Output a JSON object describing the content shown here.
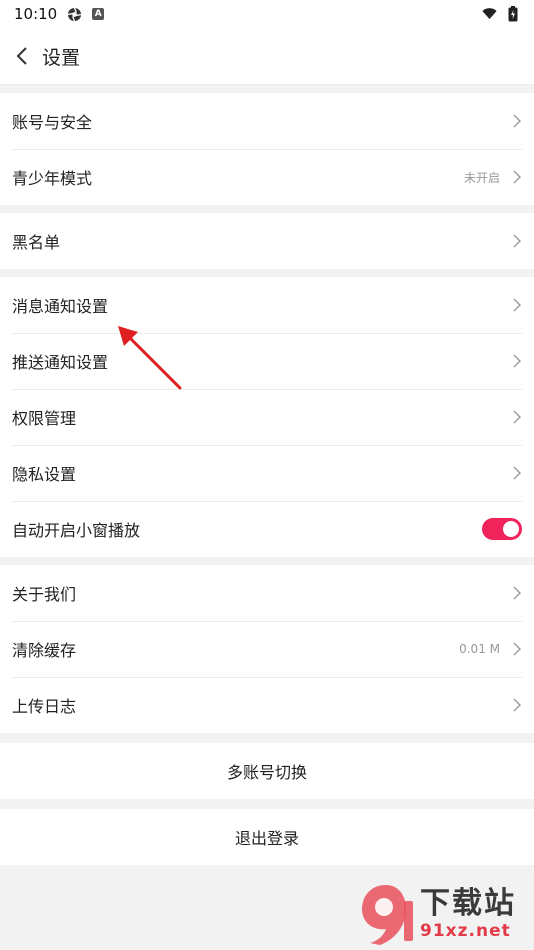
{
  "status_bar": {
    "time": "10:10"
  },
  "header": {
    "title": "设置"
  },
  "groups": [
    {
      "items": [
        {
          "label": "账号与安全",
          "value": ""
        },
        {
          "label": "青少年模式",
          "value": "未开启"
        }
      ]
    },
    {
      "items": [
        {
          "label": "黑名单",
          "value": ""
        }
      ]
    },
    {
      "items": [
        {
          "label": "消息通知设置",
          "value": ""
        },
        {
          "label": "推送通知设置",
          "value": ""
        },
        {
          "label": "权限管理",
          "value": ""
        },
        {
          "label": "隐私设置",
          "value": ""
        },
        {
          "label": "自动开启小窗播放",
          "value": "",
          "toggle_on": true
        }
      ]
    },
    {
      "items": [
        {
          "label": "关于我们",
          "value": ""
        },
        {
          "label": "清除缓存",
          "value": "0.01 M"
        },
        {
          "label": "上传日志",
          "value": ""
        }
      ]
    }
  ],
  "actions": {
    "switch_account": "多账号切换",
    "logout": "退出登录"
  },
  "colors": {
    "toggle_on": "#f0245a",
    "annotation_arrow": "#e02020"
  },
  "watermark": {
    "brand": "下载站",
    "url": "91xz.net"
  }
}
